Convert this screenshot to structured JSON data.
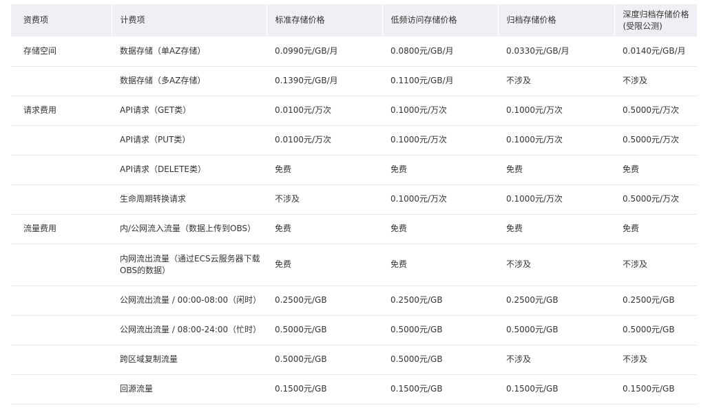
{
  "headers": [
    "资费项",
    "计费项",
    "标准存储价格",
    "低频访问存储价格",
    "归档存储价格",
    "深度归档存储价格\n(受限公测)"
  ],
  "rows": [
    {
      "category": "存储空间",
      "item": "数据存储（单AZ存储）",
      "standard": "0.0990元/GB/月",
      "infrequent": "0.0800元/GB/月",
      "archive": "0.0330元/GB/月",
      "deep_archive": "0.0140元/GB/月"
    },
    {
      "category": "",
      "item": "数据存储（多AZ存储）",
      "standard": "0.1390元/GB/月",
      "infrequent": "0.1100元/GB/月",
      "archive": "不涉及",
      "deep_archive": "不涉及"
    },
    {
      "category": "请求费用",
      "item": "API请求（GET类）",
      "standard": "0.0100元/万次",
      "infrequent": "0.1000元/万次",
      "archive": "0.1000元/万次",
      "deep_archive": "0.5000元/万次"
    },
    {
      "category": "",
      "item": "API请求（PUT类）",
      "standard": "0.0100元/万次",
      "infrequent": "0.1000元/万次",
      "archive": "0.1000元/万次",
      "deep_archive": "0.5000元/万次"
    },
    {
      "category": "",
      "item": "API请求（DELETE类）",
      "standard": "免费",
      "infrequent": "免费",
      "archive": "免费",
      "deep_archive": "免费"
    },
    {
      "category": "",
      "item": "生命周期转换请求",
      "standard": "不涉及",
      "infrequent": "0.1000元/万次",
      "archive": "0.1000元/万次",
      "deep_archive": "0.5000元/万次"
    },
    {
      "category": "流量费用",
      "item": "内/公网流入流量（数据上传到OBS）",
      "standard": "免费",
      "infrequent": "免费",
      "archive": "免费",
      "deep_archive": "免费"
    },
    {
      "category": "",
      "item": "内网流出流量（通过ECS云服务器下载OBS的数据）",
      "standard": "免费",
      "infrequent": "免费",
      "archive": "不涉及",
      "deep_archive": "不涉及"
    },
    {
      "category": "",
      "item": "公网流出流量 / 00:00-08:00（闲时）",
      "standard": "0.2500元/GB",
      "infrequent": "0.2500元/GB",
      "archive": "0.2500元/GB",
      "deep_archive": "0.2500元/GB"
    },
    {
      "category": "",
      "item": "公网流出流量 / 08:00-24:00（忙时）",
      "standard": "0.5000元/GB",
      "infrequent": "0.5000元/GB",
      "archive": "0.5000元/GB",
      "deep_archive": "0.5000元/GB"
    },
    {
      "category": "",
      "item": "跨区域复制流量",
      "standard": "0.5000元/GB",
      "infrequent": "0.5000元/GB",
      "archive": "不涉及",
      "deep_archive": "不涉及"
    },
    {
      "category": "",
      "item": "回源流量",
      "standard": "0.1500元/GB",
      "infrequent": "0.1500元/GB",
      "archive": "0.1500元/GB",
      "deep_archive": "0.1500元/GB"
    }
  ]
}
